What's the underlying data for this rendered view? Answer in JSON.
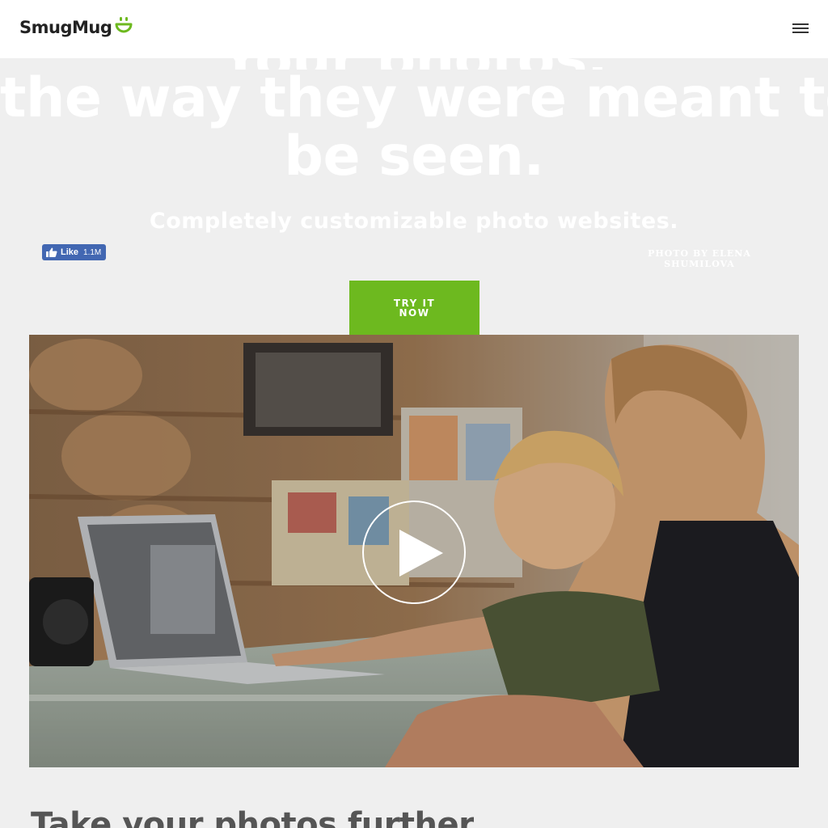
{
  "header": {
    "logo_text": "SmugMug",
    "menu_icon": "hamburger-menu-icon"
  },
  "hero": {
    "title_line_partial": "Your photos,",
    "title_line_2": "the way they were meant to",
    "title_line_3": "be seen.",
    "subtitle": "Completely customizable photo websites.",
    "facebook_like_label": "Like",
    "facebook_like_count": "1.1M",
    "photo_credit": "PHOTO BY ELENA SHUMILOVA",
    "cta_label": "TRY IT NOW"
  },
  "video": {
    "play_icon": "play-icon"
  },
  "section": {
    "title": "Take your photos further"
  },
  "colors": {
    "accent_green": "#6db91f",
    "page_background": "#efefef",
    "facebook_blue": "#4267b2"
  }
}
